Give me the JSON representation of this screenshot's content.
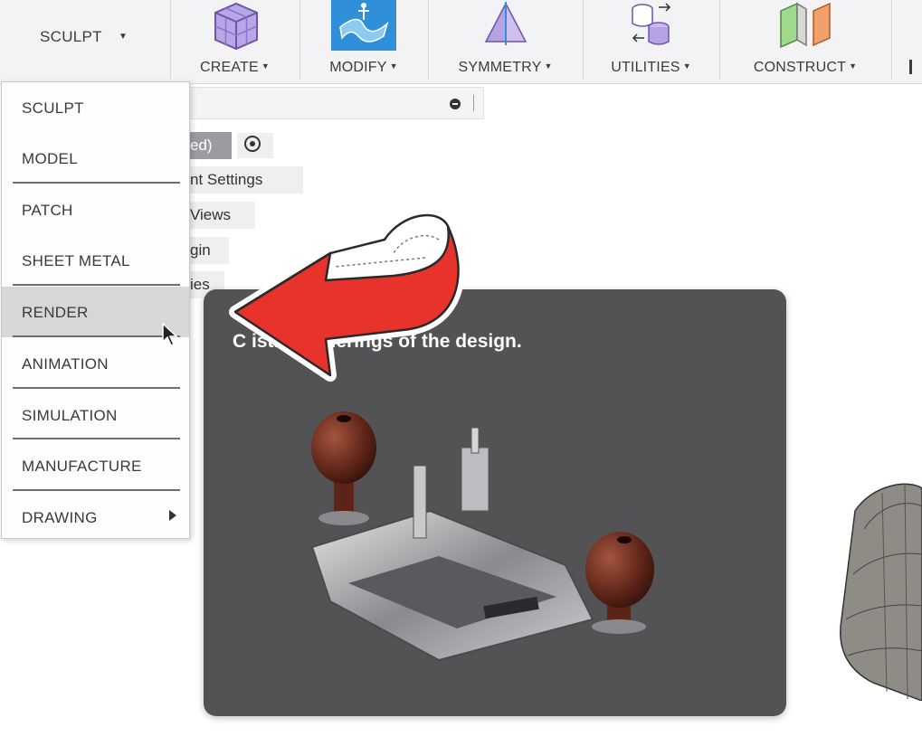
{
  "toolbar": {
    "workspace": "SCULPT",
    "groups": [
      {
        "label": "CREATE",
        "icon": "create-box-icon"
      },
      {
        "label": "MODIFY",
        "icon": "modify-surface-icon"
      },
      {
        "label": "SYMMETRY",
        "icon": "symmetry-icon"
      },
      {
        "label": "UTILITIES",
        "icon": "utilities-icon"
      },
      {
        "label": "CONSTRUCT",
        "icon": "construct-plane-icon"
      }
    ]
  },
  "browser": {
    "rows": [
      "ed)",
      "nt Settings",
      "Views",
      "gin",
      "ies"
    ]
  },
  "dropdown": {
    "items": [
      {
        "label": "SCULPT"
      },
      {
        "label": "MODEL"
      },
      {
        "label": "PATCH"
      },
      {
        "label": "SHEET METAL"
      },
      {
        "label": "RENDER"
      },
      {
        "label": "ANIMATION"
      },
      {
        "label": "SIMULATION"
      },
      {
        "label": "MANUFACTURE"
      },
      {
        "label": "DRAWING"
      }
    ]
  },
  "tooltip": {
    "text": "C               istic renderings of the design."
  },
  "colors": {
    "tooltip_bg": "#535254",
    "arrow_red": "#e8322c",
    "modify_blue": "#2f8fd8"
  }
}
